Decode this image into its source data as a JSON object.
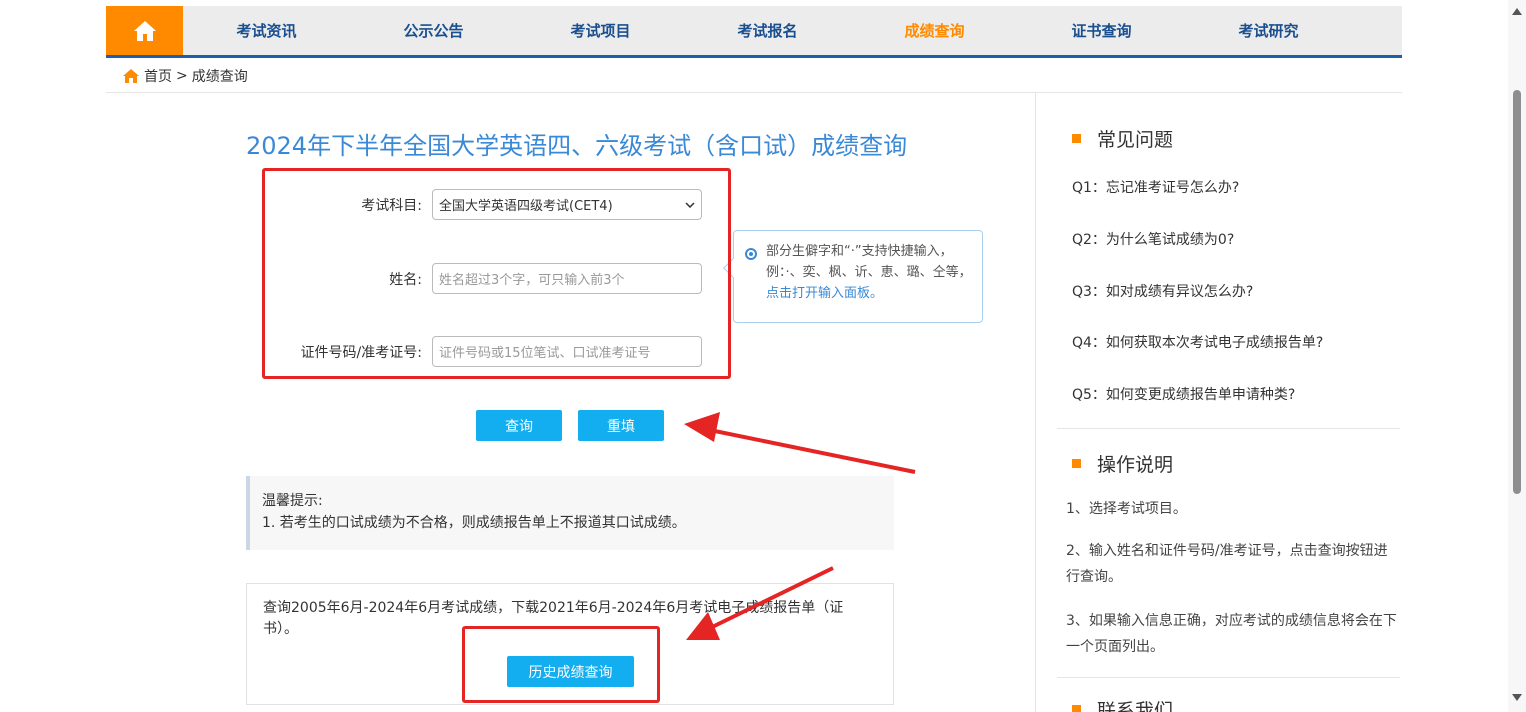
{
  "nav": {
    "home_icon": "home-icon",
    "items": [
      {
        "label": "考试资讯"
      },
      {
        "label": "公示公告"
      },
      {
        "label": "考试项目"
      },
      {
        "label": "考试报名"
      },
      {
        "label": "成绩查询",
        "active": true
      },
      {
        "label": "证书查询"
      },
      {
        "label": "考试研究"
      }
    ],
    "active_color": "#ff8a00",
    "accent_color": "#1f5ea8"
  },
  "breadcrumb": {
    "home": "首页",
    "separator": ">",
    "current": "成绩查询"
  },
  "page_title": "2024年下半年全国大学英语四、六级考试（含口试）成绩查询",
  "form": {
    "subject_label": "考试科目:",
    "subject_value": "全国大学英语四级考试(CET4)",
    "name_label": "姓名:",
    "name_placeholder": "姓名超过3个字，可只输入前3个",
    "id_label": "证件号码/准考证号:",
    "id_placeholder": "证件号码或15位笔试、口试准考证号",
    "query_button": "查询",
    "reset_button": "重填"
  },
  "tooltip": {
    "text": "部分生僻字和“·”支持快捷输入，例：·、奕、枫、䜣、恵、璐、仝等，",
    "link": "点击打开输入面板。"
  },
  "notice": {
    "title": "温馨提示:",
    "line1": "1. 若考生的口试成绩为不合格，则成绩报告单上不报道其口试成绩。"
  },
  "history": {
    "text": "查询2005年6月-2024年6月考试成绩，下载2021年6月-2024年6月考试电子成绩报告单（证书）。",
    "button": "历史成绩查询"
  },
  "sidebar": {
    "faq_title": "常见问题",
    "faq": [
      {
        "q": "Q1：忘记准考证号怎么办?"
      },
      {
        "q": "Q2：为什么笔试成绩为0?"
      },
      {
        "q": "Q3：如对成绩有异议怎么办?"
      },
      {
        "q": "Q4：如何获取本次考试电子成绩报告单?"
      },
      {
        "q": "Q5：如何变更成绩报告单申请种类?"
      }
    ],
    "ops_title": "操作说明",
    "ops": [
      "1、选择考试项目。",
      "2、输入姓名和证件号码/准考证号，点击查询按钮进行查询。",
      "3、如果输入信息正确，对应考试的成绩信息将会在下一个页面列出。"
    ],
    "contact_title": "联系我们"
  },
  "colors": {
    "button": "#13aef0",
    "title": "#3a89d6",
    "annotation_red": "#e52424",
    "bullet": "#ff8a00"
  }
}
